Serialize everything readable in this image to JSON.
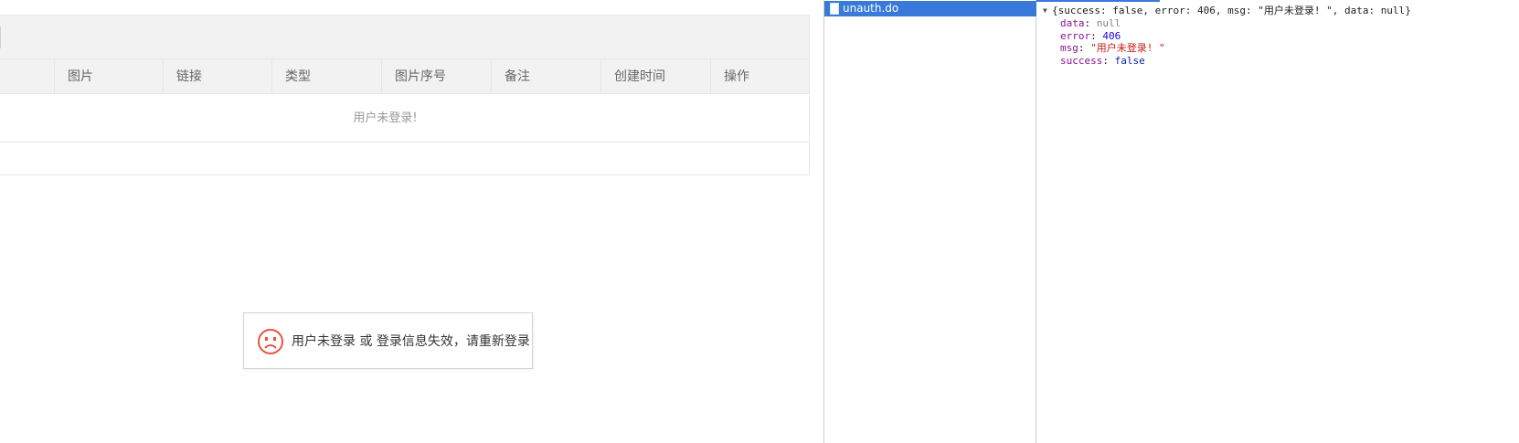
{
  "table": {
    "columns": [
      "图片",
      "链接",
      "类型",
      "图片序号",
      "备注",
      "创建时间",
      "操作"
    ],
    "empty_text": "用户未登录!"
  },
  "toast": {
    "icon": "sad-face-icon",
    "message": "用户未登录 或 登录信息失效，请重新登录",
    "icon_color": "#e8543e"
  },
  "devtools": {
    "request_name": "unauth.do",
    "summary": {
      "open": "{success: ",
      "success": "false",
      "sep1": ", error: ",
      "error": "406",
      "sep2": ", msg: ",
      "msg": "\"用户未登录! \"",
      "sep3": ", data: ",
      "data": "null",
      "close": "}"
    },
    "props": [
      {
        "key": "data",
        "value": "null"
      },
      {
        "key": "error",
        "value": "406"
      },
      {
        "key": "msg",
        "value": "\"用户未登录! \""
      },
      {
        "key": "success",
        "value": "false"
      }
    ],
    "accent_color": "#3879d9"
  }
}
